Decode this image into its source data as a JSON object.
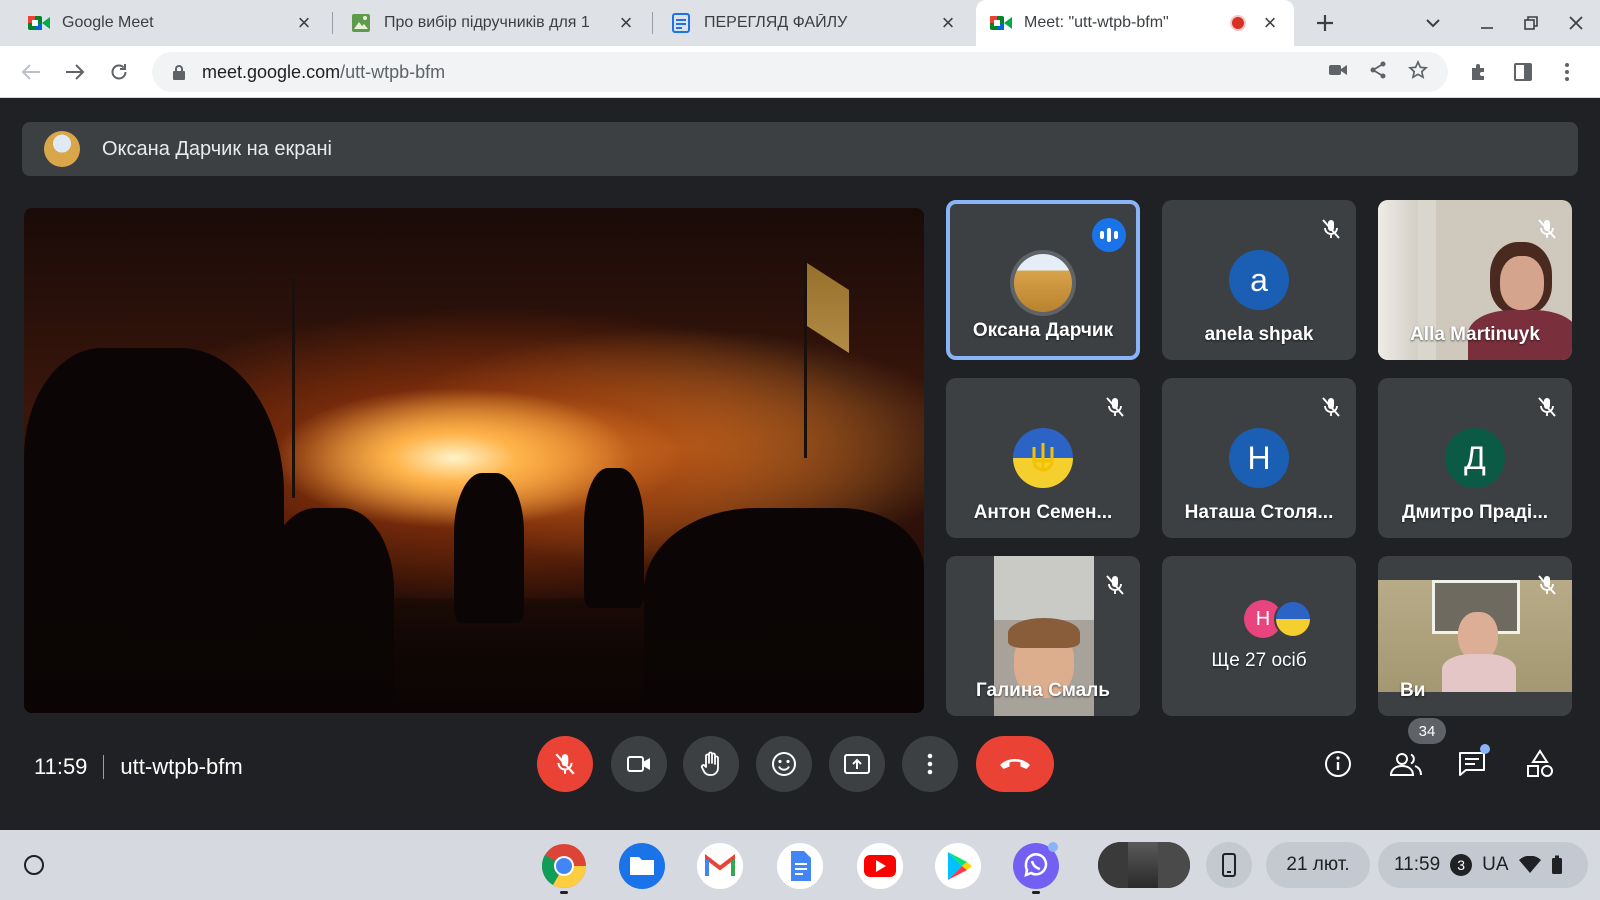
{
  "browser": {
    "tabs": [
      {
        "title": "Google Meet",
        "icon": "meet-icon",
        "active": false
      },
      {
        "title": "Про вибір підручників для 1",
        "icon": "image-doc-icon",
        "active": false
      },
      {
        "title": "ПЕРЕГЛЯД ФАЙЛУ",
        "icon": "file-view-icon",
        "active": false
      },
      {
        "title": "Meet: \"utt-wtpb-bfm\"",
        "icon": "meet-icon",
        "active": true,
        "recording": true
      }
    ],
    "url_host": "meet.google.com",
    "url_path": "/utt-wtpb-bfm"
  },
  "meet": {
    "presenting_text": "Оксана Дарчик на екрані",
    "participants": [
      {
        "name": "Оксана Дарчик",
        "type": "image",
        "speaking": true
      },
      {
        "name": "anela shpak",
        "type": "letter",
        "letter": "a",
        "color": "#1a5fb4",
        "muted": true
      },
      {
        "name": "Alla Martinuyk",
        "type": "video",
        "muted": true
      },
      {
        "name": "Антон Семен...",
        "type": "image",
        "muted": true
      },
      {
        "name": "Наташа Столя...",
        "type": "letter",
        "letter": "Н",
        "color": "#1a5fb4",
        "muted": true
      },
      {
        "name": "Дмитро Праді...",
        "type": "letter",
        "letter": "Д",
        "color": "#0b5a46",
        "muted": true
      },
      {
        "name": "Галина Смаль",
        "type": "video",
        "muted": true
      },
      {
        "name": "Ще 27 осіб",
        "type": "more",
        "letter": "Н",
        "color": "#e8457e"
      },
      {
        "name": "Ви",
        "type": "video",
        "muted": true
      }
    ],
    "time": "11:59",
    "meeting_code": "utt-wtpb-bfm",
    "people_count": "34",
    "colors": {
      "accent": "#8ab4f8",
      "danger": "#ea4335",
      "surface": "#3c4043",
      "background": "#202124"
    }
  },
  "shelf": {
    "apps": [
      "chrome-icon",
      "files-icon",
      "gmail-icon",
      "docs-icon",
      "youtube-icon",
      "play-store-icon",
      "viber-icon"
    ],
    "date": "21 лют.",
    "time": "11:59",
    "notifications": "3",
    "keyboard_layout": "UA"
  }
}
